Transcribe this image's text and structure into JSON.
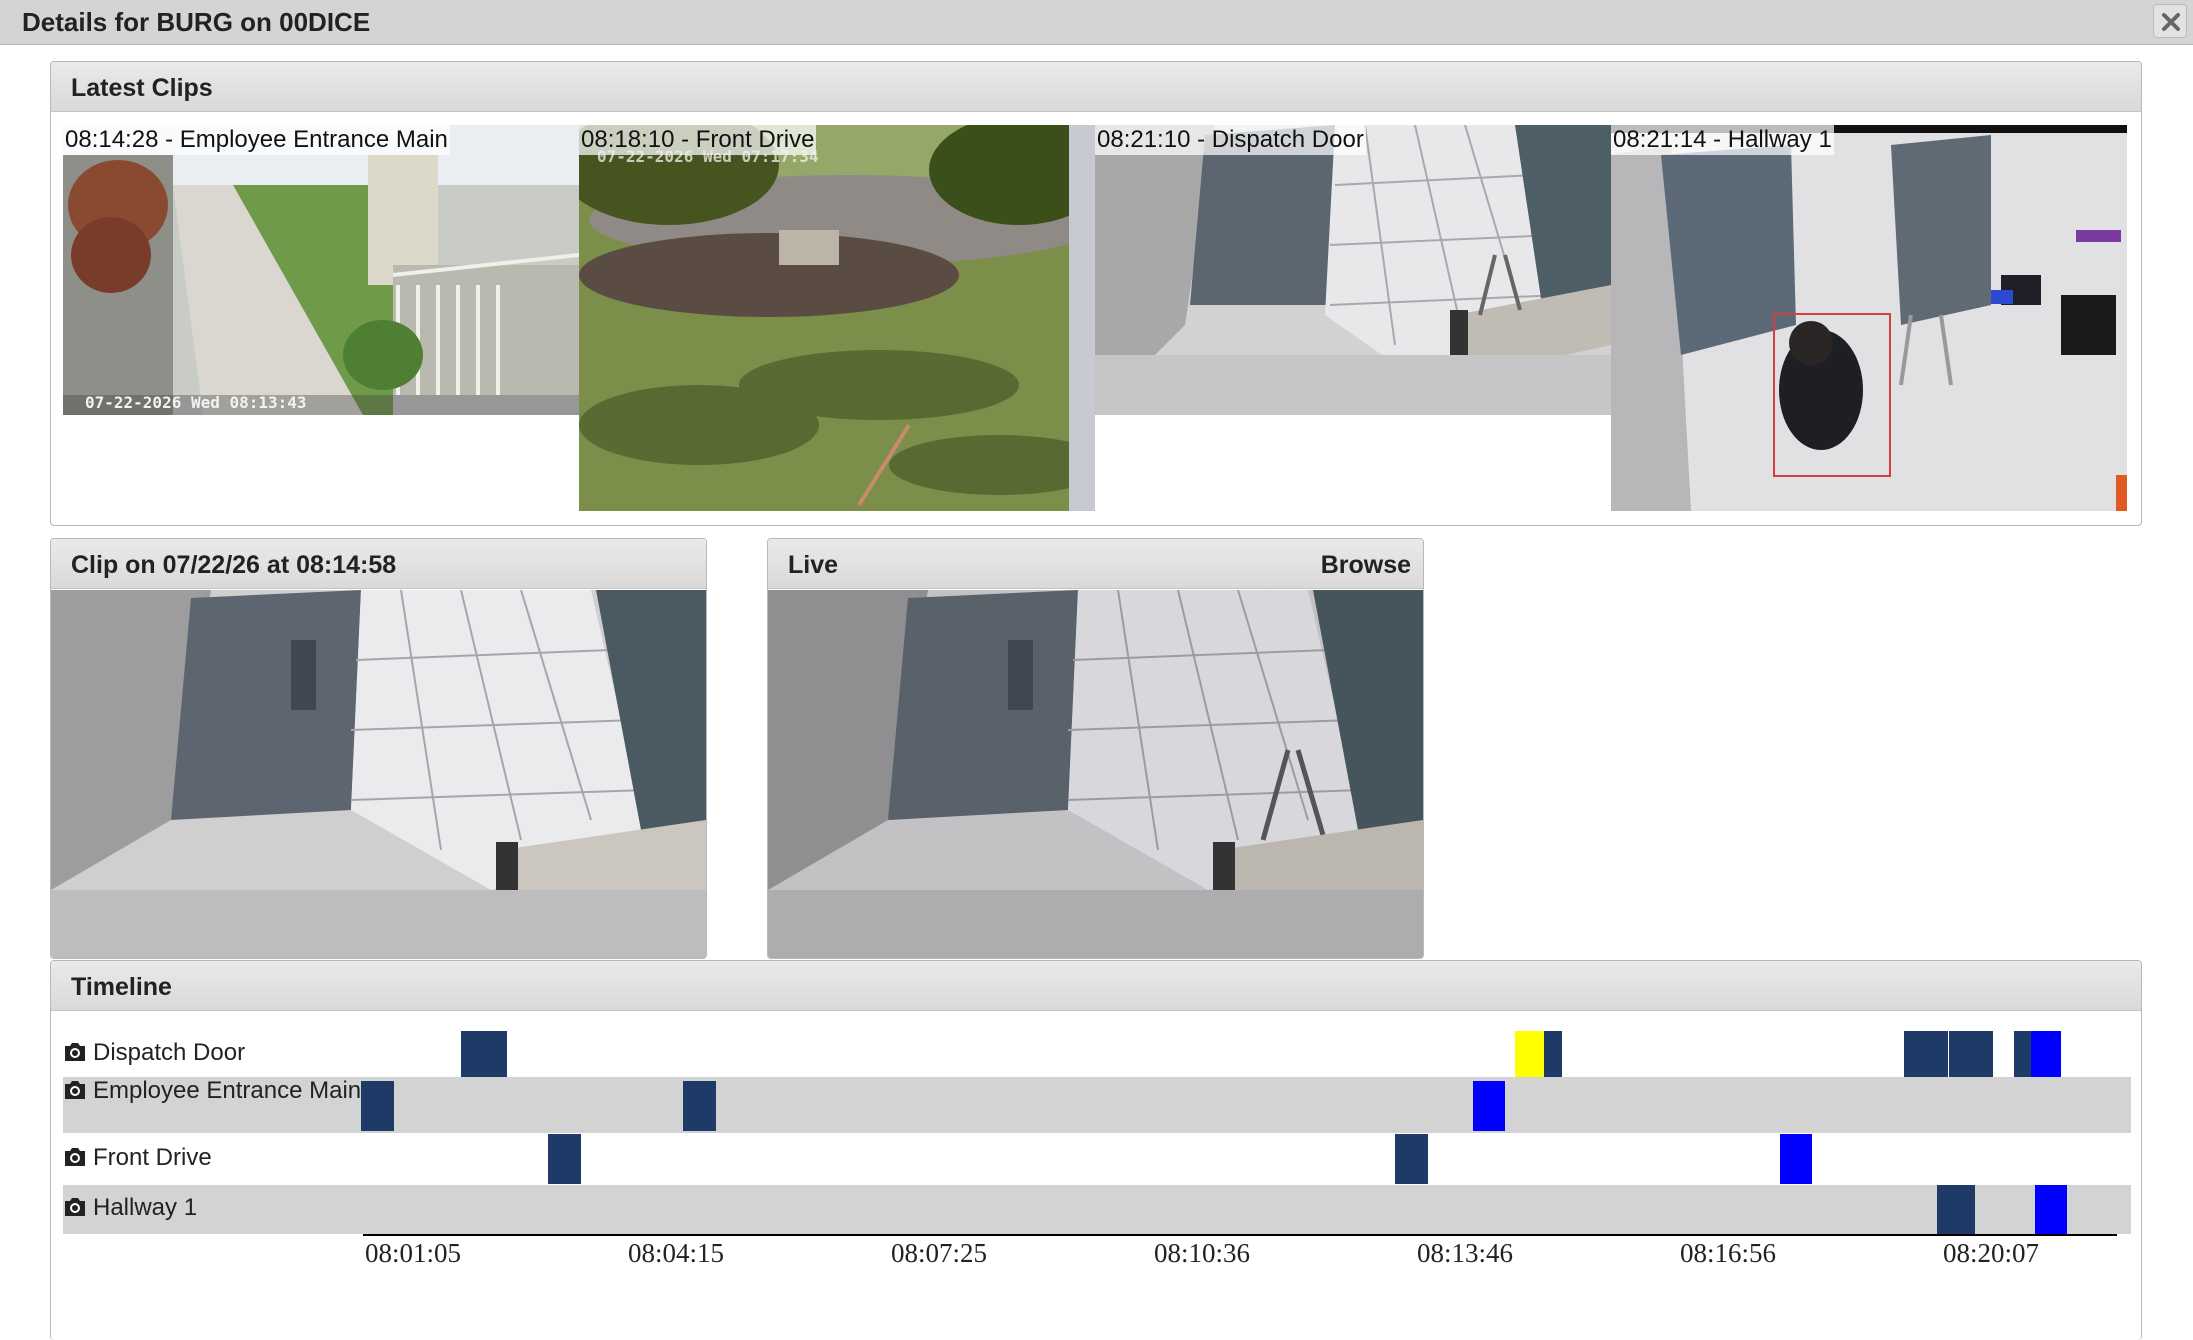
{
  "window": {
    "title": "Details for BURG on 00DICE",
    "close_icon": "close-icon"
  },
  "latest_clips": {
    "title": "Latest Clips",
    "clips": [
      {
        "label": "08:14:28 - Employee Entrance Main",
        "stamp": "07-22-2026 Wed 08:13:43"
      },
      {
        "label": "08:18:10 - Front Drive",
        "stamp": "07-22-2026 Wed 07:17:34"
      },
      {
        "label": "08:21:10 - Dispatch Door"
      },
      {
        "label": "08:21:14 - Hallway 1"
      }
    ]
  },
  "clip_panel": {
    "title": "Clip on 07/22/26 at 08:14:58"
  },
  "live_panel": {
    "title": "Live",
    "browse_label": "Browse"
  },
  "timeline": {
    "title": "Timeline",
    "colors": {
      "normal": "#1e3a66",
      "alert": "#0000ff",
      "warning": "#ffff00"
    },
    "rows": [
      {
        "label": "Dispatch Door"
      },
      {
        "label": "Employee Entrance Main"
      },
      {
        "label": "Front Drive"
      },
      {
        "label": "Hallway 1"
      }
    ],
    "axis_ticks": [
      "08:01:05",
      "08:04:15",
      "08:07:25",
      "08:10:36",
      "08:13:46",
      "08:16:56",
      "08:20:07"
    ]
  }
}
